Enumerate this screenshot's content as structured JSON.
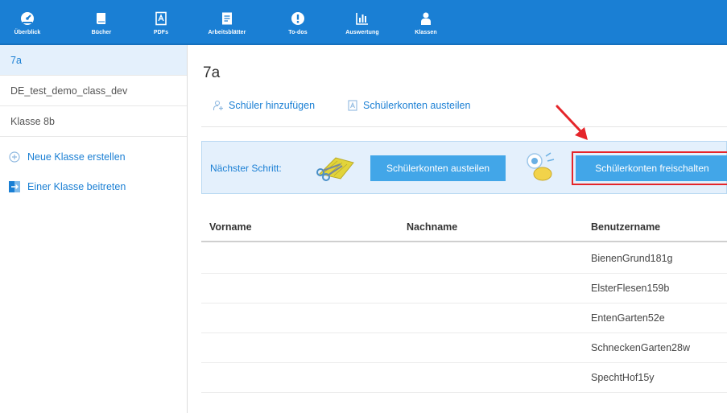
{
  "nav": {
    "items": [
      {
        "label": "Überblick",
        "icon": "overview-icon"
      },
      {
        "label": "Bücher",
        "icon": "book-icon"
      },
      {
        "label": "PDFs",
        "icon": "pdf-icon"
      },
      {
        "label": "Arbeitsblätter",
        "icon": "worksheet-icon"
      },
      {
        "label": "To-dos",
        "icon": "exclamation-icon"
      },
      {
        "label": "Auswertung",
        "icon": "chart-icon"
      },
      {
        "label": "Klassen",
        "icon": "person-icon"
      }
    ]
  },
  "sidebar": {
    "classes": [
      "7a",
      "DE_test_demo_class_dev",
      "Klasse 8b"
    ],
    "actions": [
      {
        "label": "Neue Klasse erstellen",
        "icon": "plus-circle-icon"
      },
      {
        "label": "Einer Klasse beitreten",
        "icon": "join-class-icon"
      }
    ]
  },
  "main": {
    "title": "7a",
    "actions": [
      {
        "label": "Schüler hinzufügen",
        "icon": "add-student-icon"
      },
      {
        "label": "Schülerkonten austeilen",
        "icon": "pdf-icon"
      }
    ],
    "next_step": {
      "label": "Nächster Schritt:",
      "buttons": [
        "Schülerkonten austeilen",
        "Schülerkonten freischalten"
      ]
    },
    "table": {
      "headers": [
        "Vorname",
        "Nachname",
        "Benutzername"
      ],
      "rows": [
        [
          "",
          "",
          "BienenGrund181g"
        ],
        [
          "",
          "",
          "ElsterFlesen159b"
        ],
        [
          "",
          "",
          "EntenGarten52e"
        ],
        [
          "",
          "",
          "SchneckenGarten28w"
        ],
        [
          "",
          "",
          "SpechtHof15y"
        ]
      ]
    }
  },
  "colors": {
    "brand": "#1a7fd4",
    "button": "#42a6e8",
    "highlight": "#e5252a",
    "panel": "#e4f0fc"
  }
}
